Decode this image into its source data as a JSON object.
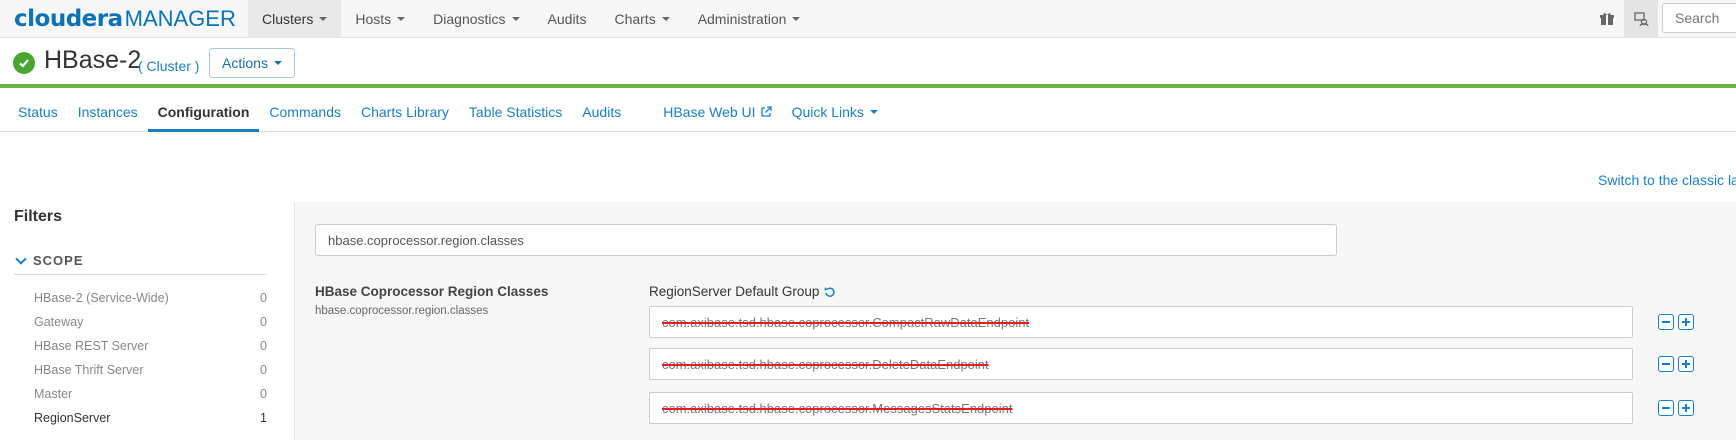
{
  "brand": {
    "name": "cloudera",
    "product": "MANAGER"
  },
  "topnav": {
    "items": [
      {
        "label": "Clusters",
        "dropdown": true,
        "active": true
      },
      {
        "label": "Hosts",
        "dropdown": true
      },
      {
        "label": "Diagnostics",
        "dropdown": true
      },
      {
        "label": "Audits",
        "dropdown": false
      },
      {
        "label": "Charts",
        "dropdown": true
      },
      {
        "label": "Administration",
        "dropdown": true
      }
    ],
    "icons": [
      "gift-icon",
      "support-icon"
    ],
    "search_placeholder": "Search"
  },
  "service": {
    "name": "HBase-2",
    "type": "( Cluster )",
    "status": "good",
    "actions_label": "Actions"
  },
  "tabs": [
    {
      "label": "Status"
    },
    {
      "label": "Instances"
    },
    {
      "label": "Configuration",
      "active": true
    },
    {
      "label": "Commands"
    },
    {
      "label": "Charts Library"
    },
    {
      "label": "Table Statistics"
    },
    {
      "label": "Audits"
    },
    {
      "label": "HBase Web UI",
      "external": true
    },
    {
      "label": "Quick Links",
      "dropdown": true
    }
  ],
  "switch_link": "Switch to the classic la",
  "filters": {
    "title": "Filters",
    "scope_title": "SCOPE",
    "scope_items": [
      {
        "label": "HBase-2 (Service-Wide)",
        "count": "0"
      },
      {
        "label": "Gateway",
        "count": "0"
      },
      {
        "label": "HBase REST Server",
        "count": "0"
      },
      {
        "label": "HBase Thrift Server",
        "count": "0"
      },
      {
        "label": "Master",
        "count": "0"
      },
      {
        "label": "RegionServer",
        "count": "1",
        "selected": true
      }
    ]
  },
  "config": {
    "search_value": "hbase.coprocessor.region.classes",
    "property": {
      "label": "HBase Coprocessor Region Classes",
      "key": "hbase.coprocessor.region.classes",
      "group": "RegionServer Default Group",
      "values": [
        "com.axibase.tsd.hbase.coprocessor.CompactRawDataEndpoint",
        "com.axibase.tsd.hbase.coprocessor.DeleteDataEndpoint",
        "com.axibase.tsd.hbase.coprocessor.MessagesStatsEndpoint"
      ]
    }
  },
  "colors": {
    "link": "#1a7fc1",
    "status_green": "#4aa531",
    "header_rule": "#6cb33f",
    "strike": "#e02020"
  }
}
